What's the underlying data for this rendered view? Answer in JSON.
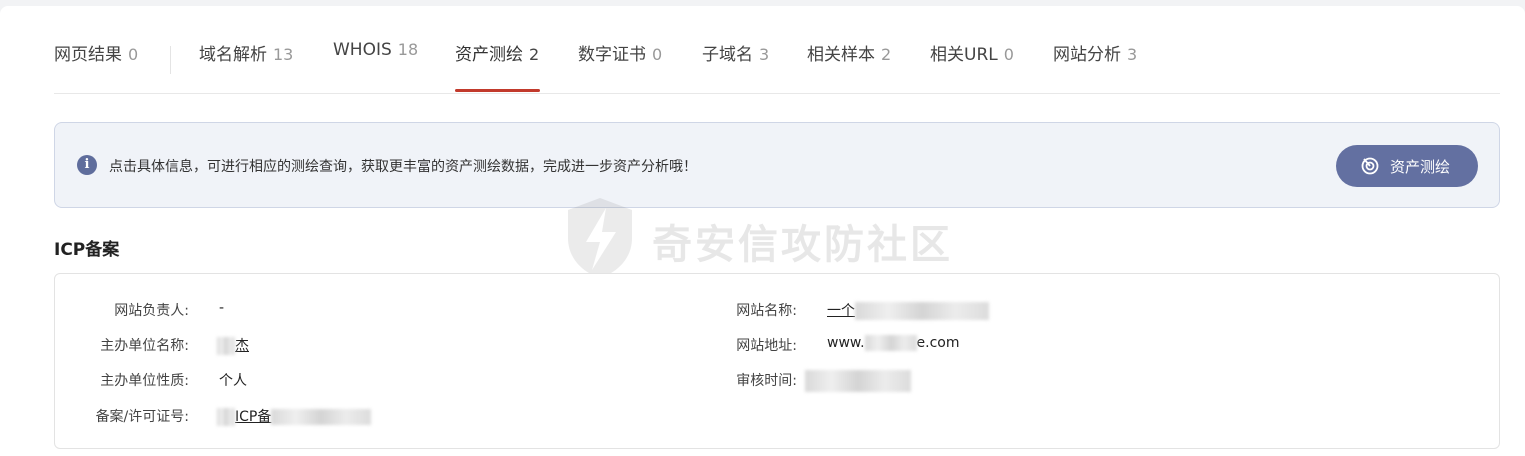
{
  "tabs": [
    {
      "label": "网页结果",
      "count": "0"
    },
    {
      "label": "域名解析",
      "count": "13"
    },
    {
      "label": "WHOIS",
      "count": "18"
    },
    {
      "label": "资产测绘",
      "count": "2"
    },
    {
      "label": "数字证书",
      "count": "0"
    },
    {
      "label": "子域名",
      "count": "3"
    },
    {
      "label": "相关样本",
      "count": "2"
    },
    {
      "label": "相关URL",
      "count": "0"
    },
    {
      "label": "网站分析",
      "count": "3"
    }
  ],
  "active_tab": "资产测绘",
  "notice": {
    "icon": "info-icon",
    "message": "点击具体信息，可进行相应的测绘查询，获取更丰富的资产测绘数据，完成进一步资产分析哦！",
    "button_label": "资产测绘",
    "button_icon": "radar-icon"
  },
  "section_title": "ICP备案",
  "icp": {
    "left": [
      {
        "label": "网站负责人:",
        "value": "-"
      },
      {
        "label": "主办单位名称:",
        "value": "杰"
      },
      {
        "label": "主办单位性质:",
        "value": "个人"
      },
      {
        "label": "备案/许可证号:",
        "value": "ICP备"
      }
    ],
    "right": [
      {
        "label": "网站名称:",
        "value": "一个"
      },
      {
        "label": "网站地址:",
        "value_prefix": "www.",
        "value_suffix": "e.com"
      },
      {
        "label": "审核时间:",
        "value": ""
      }
    ]
  },
  "watermark": "奇安信攻防社区",
  "colors": {
    "accent_tab": "#c23a2c",
    "button_bg": "#6370a1",
    "notice_bg": "#f0f3f8"
  }
}
